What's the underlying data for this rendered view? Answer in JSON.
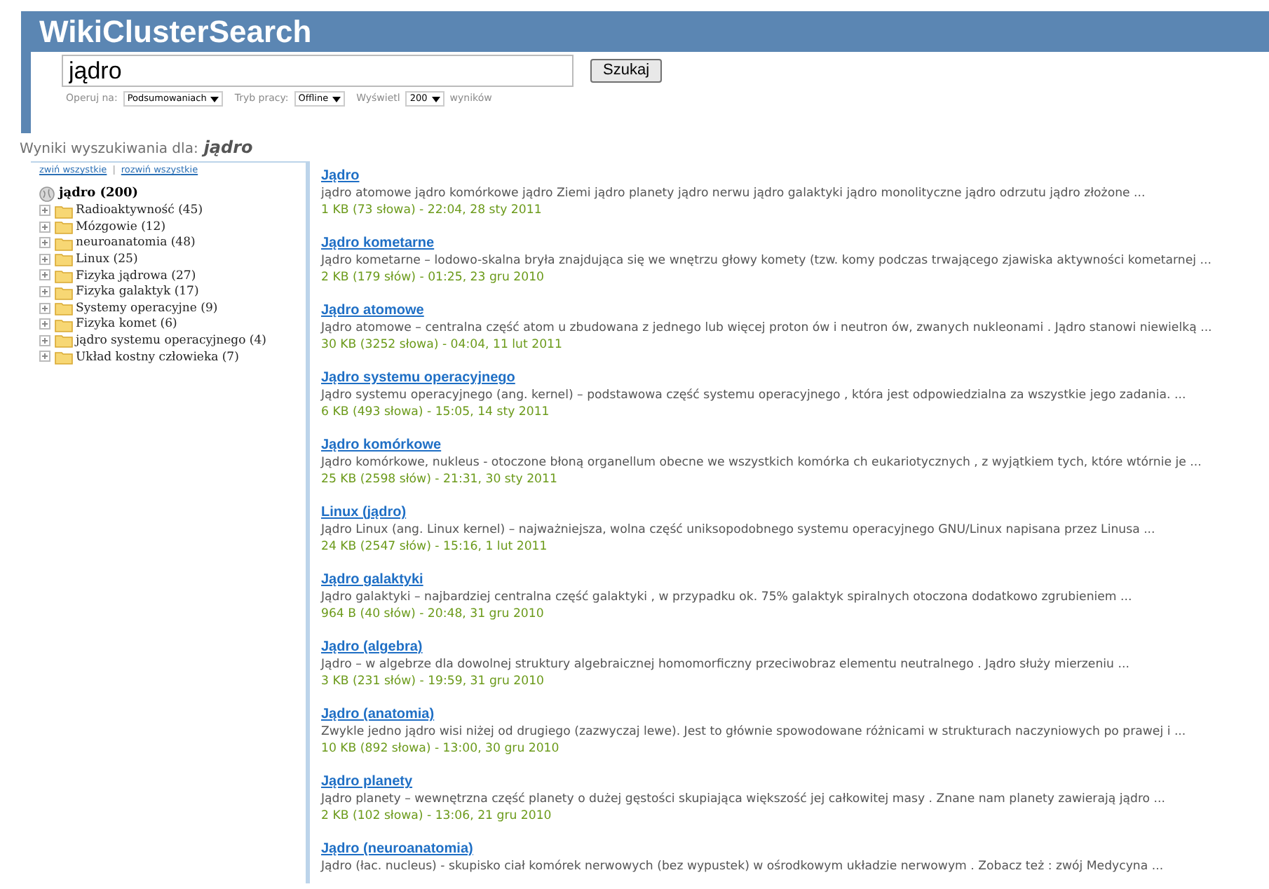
{
  "header": {
    "title": "WikiClusterSearch"
  },
  "search": {
    "value": "jądro",
    "button": "Szukaj"
  },
  "options": [
    {
      "label": "Operuj na:",
      "value": "Podsumowaniach"
    },
    {
      "label": "Tryb pracy:",
      "value": "Offline"
    },
    {
      "label": "Wyświetl",
      "value": "200",
      "suffix": "wyników"
    }
  ],
  "results_heading": {
    "label": "Wyniki wyszukiwania dla:",
    "query": "jądro"
  },
  "tree_controls": {
    "collapse": "zwiń wszystkie",
    "separator": "|",
    "expand": "rozwiń wszystkie"
  },
  "tree": {
    "label": "jądro (200)",
    "children": [
      {
        "label": "Radioaktywność (45)",
        "expanded": false
      },
      {
        "label": "Mózgowie (12)",
        "expanded": false
      },
      {
        "label": "neuroanatomia (48)",
        "expanded": false
      },
      {
        "label": "Linux (25)",
        "expanded": false
      },
      {
        "label": "Fizyka jądrowa (27)",
        "expanded": false
      },
      {
        "label": "Fizyka galaktyk (17)",
        "expanded": false
      },
      {
        "label": "Systemy operacyjne (9)",
        "expanded": false
      },
      {
        "label": "Fizyka komet (6)",
        "expanded": false
      },
      {
        "label": "jądro systemu operacyjnego (4)",
        "expanded": false
      },
      {
        "label": "Układ kostny człowieka (7)",
        "expanded": false
      }
    ]
  },
  "results": [
    {
      "title": "Jądro",
      "snippet": "jądro atomowe jądro komórkowe jądro Ziemi jądro planety jądro nerwu jądro galaktyki jądro monolityczne jądro odrzutu jądro złożone ...",
      "meta": "1 KB (73 słowa) - 22:04, 28 sty 2011"
    },
    {
      "title": "Jądro kometarne",
      "snippet": "Jądro kometarne – lodowo-skalna bryła znajdująca się we wnętrzu głowy komety (tzw. komy podczas trwającego zjawiska aktywności kometarnej ...",
      "meta": "2 KB (179 słów) - 01:25, 23 gru 2010"
    },
    {
      "title": "Jądro atomowe",
      "snippet": "Jądro atomowe – centralna część atom u zbudowana z jednego lub więcej proton ów i neutron ów, zwanych nukleonami . Jądro stanowi niewielką ...",
      "meta": "30 KB (3252 słowa) - 04:04, 11 lut 2011"
    },
    {
      "title": "Jądro systemu operacyjnego",
      "snippet": "Jądro systemu operacyjnego (ang. kernel) – podstawowa część systemu operacyjnego , która jest odpowiedzialna za wszystkie jego zadania. ...",
      "meta": "6 KB (493 słowa) - 15:05, 14 sty 2011"
    },
    {
      "title": "Jądro komórkowe",
      "snippet": "Jądro komórkowe, nukleus - otoczone błoną organellum obecne we wszystkich komórka ch eukariotycznych , z wyjątkiem tych, które wtórnie je ...",
      "meta": "25 KB (2598 słów) - 21:31, 30 sty 2011"
    },
    {
      "title": "Linux (jądro)",
      "snippet": "Jądro Linux (ang. Linux kernel) – najważniejsza, wolna część uniksopodobnego systemu operacyjnego GNU/Linux napisana przez Linusa ...",
      "meta": "24 KB (2547 słów) - 15:16, 1 lut 2011"
    },
    {
      "title": "Jądro galaktyki",
      "snippet": "Jądro galaktyki – najbardziej centralna część galaktyki , w przypadku ok. 75% galaktyk spiralnych otoczona dodatkowo zgrubieniem ...",
      "meta": "964 B (40 słów) - 20:48, 31 gru 2010"
    },
    {
      "title": "Jądro (algebra)",
      "snippet": "Jądro – w algebrze dla dowolnej struktury algebraicznej homomorficzny przeciwobraz elementu neutralnego . Jądro służy mierzeniu ...",
      "meta": "3 KB (231 słów) - 19:59, 31 gru 2010"
    },
    {
      "title": "Jądro (anatomia)",
      "snippet": "Zwykle jedno jądro wisi niżej od drugiego (zazwyczaj lewe). Jest to głównie spowodowane różnicami w strukturach naczyniowych po prawej i ...",
      "meta": "10 KB (892 słowa) - 13:00, 30 gru 2010"
    },
    {
      "title": "Jądro planety",
      "snippet": "Jądro planety – wewnętrzna część planety o dużej gęstości skupiająca większość jej całkowitej masy . Znane nam planety zawierają jądro ...",
      "meta": "2 KB (102 słowa) - 13:06, 21 gru 2010"
    },
    {
      "title": "Jądro (neuroanatomia)",
      "snippet": "Jądro (łac. nucleus) - skupisko ciał komórek nerwowych (bez wypustek) w ośrodkowym układzie nerwowym . Zobacz też : zwój Medycyna ..."
    }
  ]
}
